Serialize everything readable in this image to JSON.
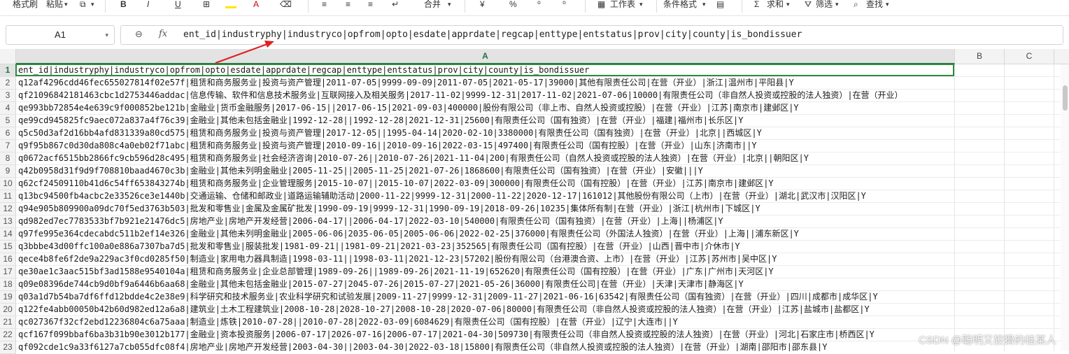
{
  "ribbon": {
    "cell_style": "格式刷",
    "paste": "粘贴",
    "merge": "合并",
    "worksheet": "工作表",
    "conditional_format": "条件格式",
    "sum": "求和",
    "filter": "筛选",
    "find": "查找"
  },
  "formula_bar": {
    "name_box": "A1",
    "fx": "fx",
    "content": "ent_id|industryphy|industryco|opfrom|opto|esdate|apprdate|regcap|enttype|entstatus|prov|city|county|is_bondissuer"
  },
  "columns": [
    "A",
    "B",
    "C"
  ],
  "rows": [
    {
      "num": "1",
      "text": "ent_id|industryphy|industryco|opfrom|opto|esdate|apprdate|regcap|enttype|entstatus|prov|city|county|is_bondissuer"
    },
    {
      "num": "2",
      "text": "q12af4296cdd46fec655027814f02e57f|租赁和商务服务业|投资与资产管理|2011-07-05|9999-09-09|2011-07-05|2021-05-17|39000|其他有限责任公司|在营（开业）|浙江|温州市|平阳县|Y"
    },
    {
      "num": "3",
      "text": "qf21096842181463cbc1d2753446addac|信息传输、软件和信息技术服务业|互联网接入及相关服务|2017-11-02|9999-12-31|2017-11-02|2021-07-06|10000|有限责任公司（非自然人投资或控股的法人独资）|在营（开业）"
    },
    {
      "num": "4",
      "text": "qe993bb72854e4e639c9f000852be121b|金融业|货币金融服务|2017-06-15||2017-06-15|2021-09-03|400000|股份有限公司（非上市、自然人投资或控股）|在营（开业）|江苏|南京市|建邺区|Y"
    },
    {
      "num": "5",
      "text": "qe99cd945825fc9aec072a837a4f76c39|金融业|其他未包括金融业|1992-12-28||1992-12-28|2021-12-31|25600|有限责任公司（国有独资）|在营（开业）|福建|福州市|长乐区|Y"
    },
    {
      "num": "6",
      "text": "q5c50d3af2d16bb4afd831339a80cd575|租赁和商务服务业|投资与资产管理|2017-12-05||1995-04-14|2020-02-10|3380000|有限责任公司（国有独资）|在营（开业）|北京||西城区|Y"
    },
    {
      "num": "7",
      "text": "q9f95b867c0d30da808c4a0eb02f71abc|租赁和商务服务业|投资与资产管理|2010-09-16||2010-09-16|2022-03-15|497400|有限责任公司（国有控股）|在营（开业）|山东|济南市||Y"
    },
    {
      "num": "8",
      "text": "q0672acf6515bb2866fc9cb596d28c495|租赁和商务服务业|社会经济咨询|2010-07-26||2010-07-26|2021-11-04|200|有限责任公司（自然人投资或控股的法人独资）|在营（开业）|北京||朝阳区|Y"
    },
    {
      "num": "9",
      "text": "q42b0958d31f9d9f708810baad4670c3b|金融业|其他未列明金融业|2005-11-25||2005-11-25|2021-07-26|1868600|有限责任公司（国有独资）|在营（开业）|安徽|||Y"
    },
    {
      "num": "10",
      "text": "q62cf24509110b41d6c54ff653843274b|租赁和商务服务业|企业管理服务|2015-10-07||2015-10-07|2022-03-09|300000|有限责任公司（国有控股）|在营（开业）|江苏|南京市|建邺区|Y"
    },
    {
      "num": "11",
      "text": "q13bc94500fb4acbc2e33526ce3e1440b|交通运输、仓储和邮政业|道路运输辅助活动|2000-11-22|9999-12-31|2000-11-22|2020-12-17|161012|其他股份有限公司（上市）|在营（开业）|湖北|武汉市|汉阳区|Y"
    },
    {
      "num": "12",
      "text": "q94e905b809900a09dc70f5ed3763b503|批发和零售业|金属及金属矿批发|1990-09-19|9999-12-31|1990-09-19|2018-09-26|10235|集体所有制|在营（开业）|浙江|杭州市|下城区|Y"
    },
    {
      "num": "13",
      "text": "qd982ed7ec7783533bf7b921e21476dc5|房地产业|房地产开发经营|2006-04-17||2006-04-17|2022-03-10|540000|有限责任公司（国有独资）|在营（开业）|上海||杨浦区|Y"
    },
    {
      "num": "14",
      "text": "q97fe995e364cdecabdc511b2ef14e326|金融业|其他未列明金融业|2005-06-06|2035-06-05|2005-06-06|2022-02-25|376000|有限责任公司（外国法人独资）|在营（开业）|上海||浦东新区|Y"
    },
    {
      "num": "15",
      "text": "q3bbbe43d00ffc100a0e886a7307ba7d5|批发和零售业|服装批发|1981-09-21||1981-09-21|2021-03-23|352565|有限责任公司（国有控股）|在营（开业）|山西|晋中市|介休市|Y"
    },
    {
      "num": "16",
      "text": "qece4b8fe6f2de9a229ac3f0cd0285f50|制造业|家用电力器具制造|1998-03-11||1998-03-11|2021-12-23|57202|股份有限公司（台港澳合资、上市）|在营（开业）|江苏|苏州市|吴中区|Y"
    },
    {
      "num": "17",
      "text": "qe30ae1c3aac515bf3ad1588e9540104a|租赁和商务服务业|企业总部管理|1989-09-26||1989-09-26|2021-11-19|652620|有限责任公司（国有控股）|在营（开业）|广东|广州市|天河区|Y"
    },
    {
      "num": "18",
      "text": "q09e08396de744cb9d0bf9a6446b6aa68|金融业|其他未包括金融业|2015-07-27|2045-07-26|2015-07-27|2021-05-26|36000|有限责任公司|在营（开业）|天津|天津市|静海区|Y"
    },
    {
      "num": "19",
      "text": "q03a1d7b54ba7df6ffd12bdde4c2e38e9|科学研究和技术服务业|农业科学研究和试验发展|2009-11-27|9999-12-31|2009-11-27|2021-06-16|63542|有限责任公司（国有独资）|在营（开业）|四川|成都市|成华区|Y"
    },
    {
      "num": "20",
      "text": "q122fe4abb00050b42b60d982ed12a6a8|建筑业|土木工程建筑业|2008-10-28|2028-10-27|2008-10-28|2020-07-06|80000|有限责任公司（非自然人投资或控股的法人独资）|在营（开业）|江苏|盐城市|盐都区|Y"
    },
    {
      "num": "21",
      "text": "qc027367f32cf2ebd12236804c6a75aaa|制造业|炼铁|2010-07-28||2010-07-28|2022-03-09|6084629|有限责任公司（国有控股）|在营（开业）|辽宁|大连市||Y"
    },
    {
      "num": "22",
      "text": "qcf167f099bbaf6ba3b31b90e3012b177|金融业|资本投资服务|2006-07-17|2026-07-16|2006-07-17|2021-04-30|509730|有限责任公司（非自然人投资或控股的法人独资）|在营（开业）|河北|石家庄市|桥西区|Y"
    },
    {
      "num": "23",
      "text": "qf092cde1c9a33f6127a7cb055dfc08f4|房地产业|房地产开发经营|2003-04-30||2003-04-30|2022-03-18|15800|有限责任公司（非自然人投资或控股的法人独资）|在营（开业）|湖南|邵阳市|邵东县|Y"
    }
  ],
  "watermark": "CSDN @聪明又狡猾的桂某人"
}
